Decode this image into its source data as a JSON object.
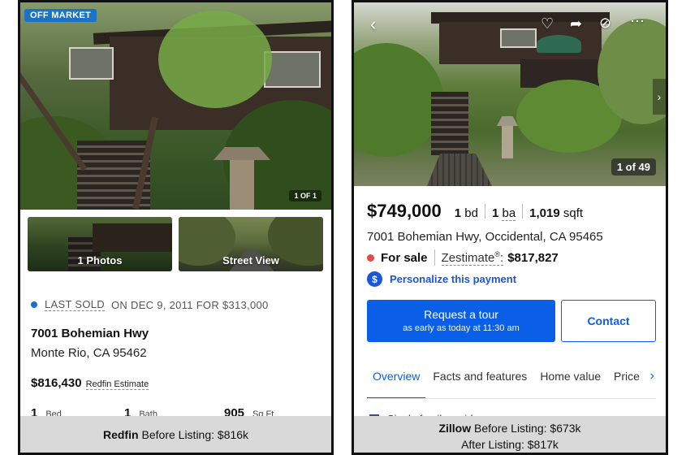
{
  "left": {
    "badge": "OFF MARKET",
    "photo_counter": "1 OF 1",
    "thumbs": [
      {
        "label": "1 Photos"
      },
      {
        "label": "Street View"
      }
    ],
    "sold": {
      "label": "LAST SOLD",
      "detail": "ON DEC 9, 2011 FOR $313,000"
    },
    "address_line1": "7001 Bohemian Hwy",
    "address_line2": "Monte Rio, CA 95462",
    "estimate_price": "$816,430",
    "estimate_label": "Redfin Estimate",
    "stats": [
      {
        "value": "1",
        "unit": "Bed"
      },
      {
        "value": "1",
        "unit": "Bath"
      },
      {
        "value": "905",
        "unit": "Sq Ft"
      }
    ],
    "caption_brand": "Redfin",
    "caption_text": "Before Listing: $816k"
  },
  "right": {
    "photo_counter": "1 of 49",
    "icons": [
      "back-arrow-icon",
      "heart-icon",
      "share-icon",
      "hide-icon",
      "more-icon",
      "chevron-right-icon"
    ],
    "price": "$749,000",
    "beds_value": "1",
    "beds_unit": "bd",
    "baths_value": "1",
    "baths_unit": "ba",
    "sqft_value": "1,019",
    "sqft_unit": "sqft",
    "address": "7001 Bohemian Hwy, Occidental, CA 95465",
    "status": "For sale",
    "zestimate_label": "Zestimate",
    "zestimate_value": "$817,827",
    "personalize": "Personalize this payment",
    "tour_title": "Request a tour",
    "tour_subtitle": "as early as today at 11:30 am",
    "contact": "Contact",
    "tabs": [
      "Overview",
      "Facts and features",
      "Home value",
      "Price"
    ],
    "hint_text": "Single family residence",
    "caption_brand": "Zillow",
    "caption_line1": "Before Listing: $673k",
    "caption_line2": "After Listing: $817k"
  },
  "colors": {
    "redfin_blue": "#1a73c7",
    "zillow_blue": "#0b5ee6",
    "for_sale_dot": "#e8484a",
    "caption_bg": "#d9d9d9"
  }
}
